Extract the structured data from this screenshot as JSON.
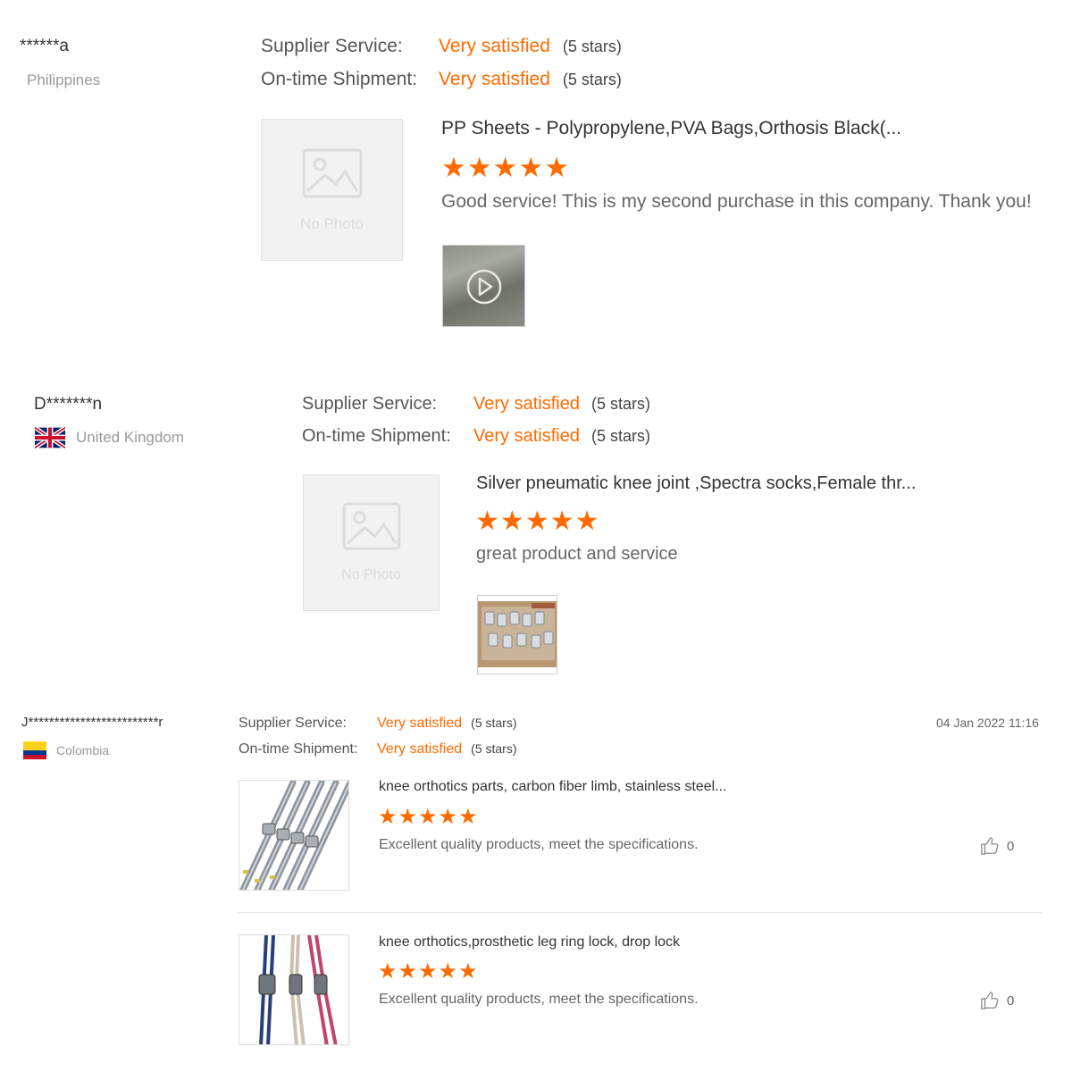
{
  "reviews": [
    {
      "buyer": "******a",
      "country": "Philippines",
      "supplier_label": "Supplier Service:",
      "supplier_value": "Very satisfied",
      "supplier_stars": "(5 stars)",
      "shipment_label": "On-time Shipment:",
      "shipment_value": "Very satisfied",
      "shipment_stars": "(5 stars)",
      "products": [
        {
          "image": "no-photo",
          "no_photo_text": "No Photo",
          "title": "PP Sheets - Polypropylene,PVA Bags,Orthosis Black(...",
          "rating": 5,
          "comment": "Good service! This is my second purchase in this company. Thank you!",
          "attachment": "video"
        }
      ]
    },
    {
      "buyer": "D*******n",
      "country": "United Kingdom",
      "flag": "uk-flag",
      "supplier_label": "Supplier Service:",
      "supplier_value": "Very satisfied",
      "supplier_stars": "(5 stars)",
      "shipment_label": "On-time Shipment:",
      "shipment_value": "Very satisfied",
      "shipment_stars": "(5 stars)",
      "products": [
        {
          "image": "no-photo",
          "no_photo_text": "No Photo",
          "title": "Silver pneumatic knee joint ,Spectra socks,Female thr...",
          "rating": 5,
          "comment": "great product and service",
          "attachment": "photo"
        }
      ]
    },
    {
      "buyer": "J*************************r",
      "country": "Colombia",
      "flag": "colombia-flag",
      "date": "04 Jan 2022 11:16",
      "supplier_label": "Supplier Service:",
      "supplier_value": "Very satisfied",
      "supplier_stars": "(5 stars)",
      "shipment_label": "On-time Shipment:",
      "shipment_value": "Very satisfied",
      "shipment_stars": "(5 stars)",
      "products": [
        {
          "image": "knee-parts-photo",
          "title": "knee orthotics parts, carbon fiber limb, stainless steel...",
          "rating": 5,
          "comment": "Excellent quality products, meet the specifications.",
          "likes": "0"
        },
        {
          "image": "ring-lock-photo",
          "title": "knee orthotics,prosthetic leg ring lock, drop lock",
          "rating": 5,
          "comment": "Excellent quality products, meet the specifications.",
          "likes": "0"
        }
      ]
    }
  ],
  "colors": {
    "accent": "#ff6a00",
    "label": "#555555",
    "muted": "#999999"
  }
}
